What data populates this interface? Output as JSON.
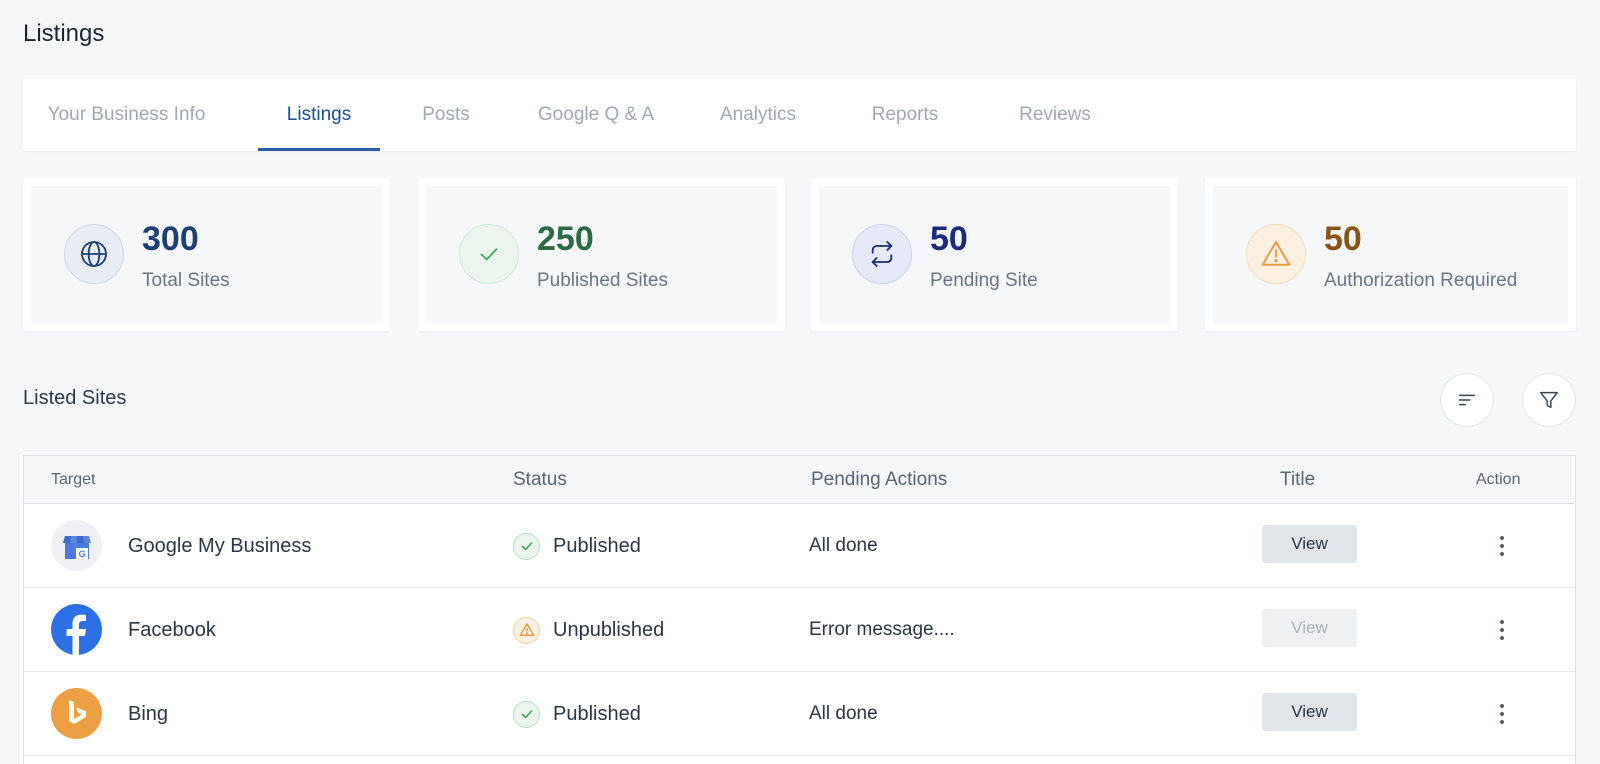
{
  "page": {
    "title": "Listings"
  },
  "tabs": [
    {
      "label": "Your Business Info",
      "active": false
    },
    {
      "label": "Listings",
      "active": true
    },
    {
      "label": "Posts",
      "active": false
    },
    {
      "label": "Google Q & A",
      "active": false
    },
    {
      "label": "Analytics",
      "active": false
    },
    {
      "label": "Reports",
      "active": false
    },
    {
      "label": "Reviews",
      "active": false
    }
  ],
  "stats": [
    {
      "value": "300",
      "label": "Total Sites",
      "icon": "globe-icon",
      "color": "#1e3f75",
      "icon_bg": "#e9eef6",
      "icon_border": "#c9d6ea"
    },
    {
      "value": "250",
      "label": "Published Sites",
      "icon": "check-icon",
      "color": "#2c6b45",
      "icon_bg": "#ebf5ee",
      "icon_border": "#cde7d6"
    },
    {
      "value": "50",
      "label": "Pending Site",
      "icon": "sync-icon",
      "color": "#1b2a7a",
      "icon_bg": "#e6e9f8",
      "icon_border": "#c8cff0"
    },
    {
      "value": "50",
      "label": "Authorization Required",
      "icon": "warning-icon",
      "color": "#8a5417",
      "icon_bg": "#fcf0e2",
      "icon_border": "#f5d9b8"
    }
  ],
  "listed_sites": {
    "title": "Listed Sites",
    "sort_icon": "sort-icon",
    "filter_icon": "filter-icon"
  },
  "table": {
    "headers": {
      "target": "Target",
      "status": "Status",
      "pending": "Pending Actions",
      "title": "Title",
      "action": "Action"
    },
    "rows": [
      {
        "name": "Google My Business",
        "logo": "google-my-business-logo",
        "status": "Published",
        "status_icon": "check-circle-icon",
        "pending": "All done",
        "view": "View",
        "view_enabled": true
      },
      {
        "name": "Facebook",
        "logo": "facebook-logo",
        "status": "Unpublished",
        "status_icon": "warning-circle-icon",
        "pending": "Error message....",
        "view": "View",
        "view_enabled": false
      },
      {
        "name": "Bing",
        "logo": "bing-logo",
        "status": "Published",
        "status_icon": "check-circle-icon",
        "pending": "All done",
        "view": "View",
        "view_enabled": true
      }
    ]
  },
  "colors": {
    "accent": "#2b5ca8",
    "published": "#3aa55d",
    "warning": "#e8953b",
    "facebook": "#2d6fe4",
    "bing": "#eca043"
  }
}
